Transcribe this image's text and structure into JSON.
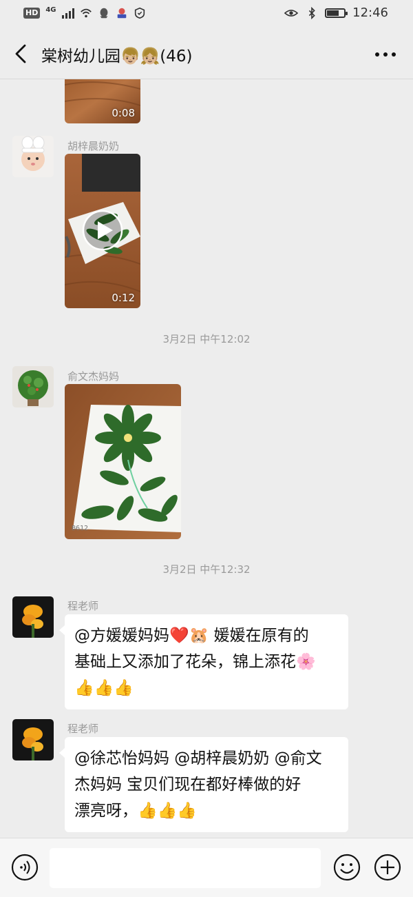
{
  "status_bar": {
    "hd_label": "HD",
    "network_label": "4G",
    "time": "12:46",
    "battery_level": 0.7
  },
  "header": {
    "group_name": "棠树幼儿园",
    "title_emojis": "👦🏼👧🏼",
    "member_count": "(46)"
  },
  "messages": [
    {
      "type": "video",
      "duration": "0:08"
    },
    {
      "type": "video",
      "sender": "胡梓晨奶奶",
      "duration": "0:12"
    },
    {
      "type": "time",
      "text": "3月2日 中午12:02"
    },
    {
      "type": "image",
      "sender": "俞文杰妈妈",
      "stamp": "B612"
    },
    {
      "type": "time",
      "text": "3月2日 中午12:32"
    },
    {
      "type": "text",
      "sender": "程老师",
      "lines": [
        "@方媛媛妈妈❤️🐹 媛媛在原有的",
        "基础上又添加了花朵，锦上添花🌸",
        "👍👍👍"
      ]
    },
    {
      "type": "text",
      "sender": "程老师",
      "lines": [
        "@徐芯怡妈妈 @胡梓晨奶奶 @俞文",
        "杰妈妈  宝贝们现在都好棒做的好",
        "漂亮呀，👍👍👍"
      ]
    }
  ],
  "icons": {
    "back": "chevron-left-icon",
    "more": "more-horizontal-icon",
    "voice": "voice-icon",
    "emoji": "smiley-icon",
    "plus": "plus-icon",
    "play": "play-icon"
  }
}
